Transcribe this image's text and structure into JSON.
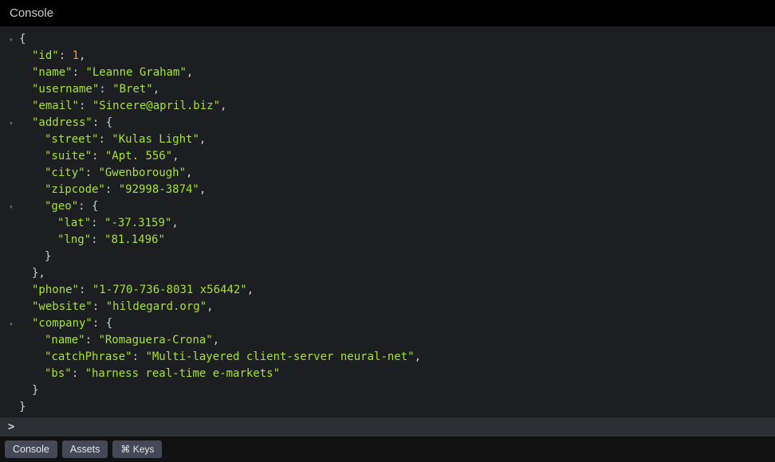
{
  "header": {
    "title": "Console"
  },
  "obj": {
    "id_key": "\"id\"",
    "id_val": "1",
    "name_key": "\"name\"",
    "name_val": "\"Leanne Graham\"",
    "username_key": "\"username\"",
    "username_val": "\"Bret\"",
    "email_key": "\"email\"",
    "email_val": "\"Sincere@april.biz\"",
    "address_key": "\"address\"",
    "street_key": "\"street\"",
    "street_val": "\"Kulas Light\"",
    "suite_key": "\"suite\"",
    "suite_val": "\"Apt. 556\"",
    "city_key": "\"city\"",
    "city_val": "\"Gwenborough\"",
    "zipcode_key": "\"zipcode\"",
    "zipcode_val": "\"92998-3874\"",
    "geo_key": "\"geo\"",
    "lat_key": "\"lat\"",
    "lat_val": "\"-37.3159\"",
    "lng_key": "\"lng\"",
    "lng_val": "\"81.1496\"",
    "phone_key": "\"phone\"",
    "phone_val": "\"1-770-736-8031 x56442\"",
    "website_key": "\"website\"",
    "website_val": "\"hildegard.org\"",
    "company_key": "\"company\"",
    "cname_key": "\"name\"",
    "cname_val": "\"Romaguera-Crona\"",
    "catch_key": "\"catchPhrase\"",
    "catch_val": "\"Multi-layered client-server neural-net\"",
    "bs_key": "\"bs\"",
    "bs_val": "\"harness real-time e-markets\""
  },
  "punct": {
    "open": "{",
    "close": "}",
    "close_comma": "},",
    "colon_sp": ": ",
    "colon_open": ": {",
    "comma": ","
  },
  "prompt": {
    "symbol": ">"
  },
  "bottom": {
    "console": "Console",
    "assets": "Assets",
    "keys": "⌘ Keys"
  }
}
